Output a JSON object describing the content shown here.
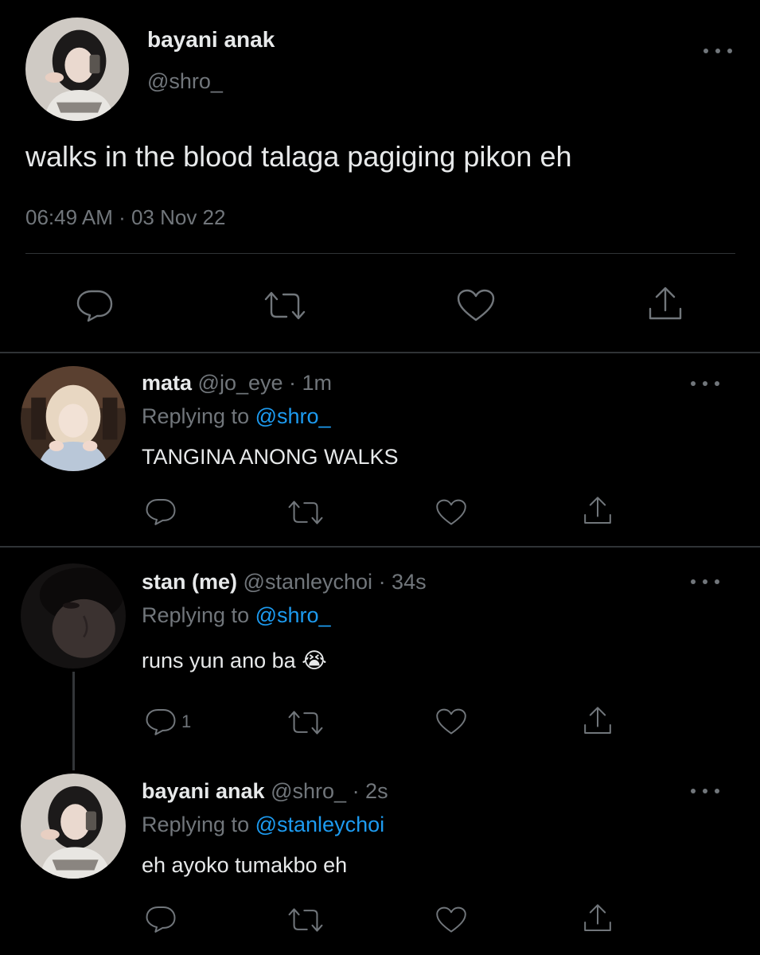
{
  "main_tweet": {
    "display_name": "bayani anak",
    "handle": "@shro_",
    "text": "walks in the blood talaga pagiging pikon eh",
    "timestamp": "06:49 AM · 03 Nov 22",
    "avatar": "avatar-bayani-anak"
  },
  "replies": [
    {
      "display_name": "mata",
      "handle": "@jo_eye",
      "time": "· 1m",
      "replying_label": "Replying to",
      "replying_to": "@shro_",
      "text": "TANGINA ANONG WALKS",
      "reply_count": ""
    },
    {
      "display_name": "stan (me)",
      "handle": "@stanleychoi",
      "time": "· 34s",
      "replying_label": "Replying to",
      "replying_to": "@shro_",
      "text": "runs yun ano ba 😭",
      "reply_count": "1"
    },
    {
      "display_name": "bayani anak",
      "handle": "@shro_",
      "time": "· 2s",
      "replying_label": "Replying to",
      "replying_to": "@stanleychoi",
      "text": "eh ayoko tumakbo eh",
      "reply_count": ""
    }
  ],
  "icons": {
    "reply": "reply-icon",
    "retweet": "retweet-icon",
    "like": "heart-icon",
    "share": "share-icon",
    "more": "more-icon"
  },
  "colors": {
    "background": "#000000",
    "text": "#e7e9ea",
    "muted": "#71767b",
    "link": "#1d9bf0",
    "divider": "#2f3336"
  }
}
